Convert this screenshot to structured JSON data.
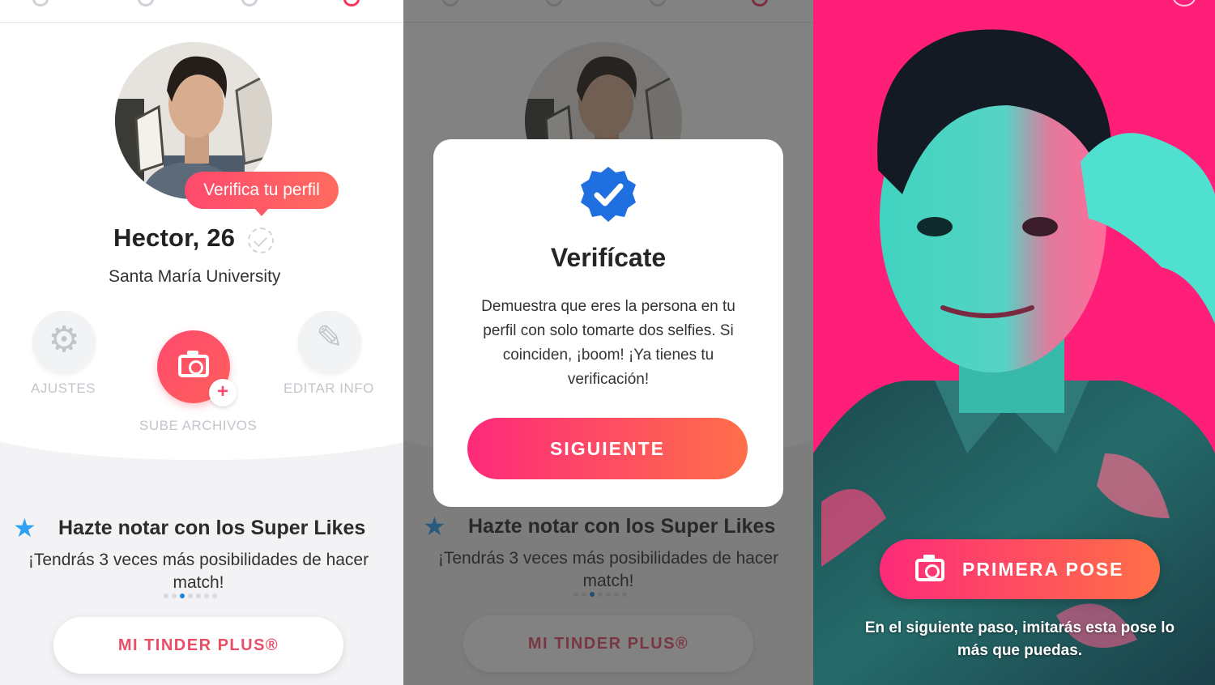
{
  "profile": {
    "verify_pill": "Verifica tu perfil",
    "name": "Hector, 26",
    "school": "Santa María University",
    "settings_label": "AJUSTES",
    "upload_label": "SUBE ARCHIVOS",
    "edit_label": "EDITAR INFO",
    "upload_plus": "+"
  },
  "promo": {
    "title": "Hazte notar con los Super Likes",
    "subtitle": "¡Tendrás 3 veces más posibilidades de hacer match!",
    "plus_button": "MI TINDER PLUS®",
    "active_dot": 2,
    "dot_count": 7
  },
  "modal": {
    "title": "Verifícate",
    "body": "Demuestra que eres la persona en tu perfil con solo tomarte dos selfies. Si coinciden, ¡boom! ¡Ya tienes tu verificación!",
    "button": "SIGUIENTE"
  },
  "pose": {
    "button": "PRIMERA POSE",
    "hint": "En el siguiente paso, imitarás esta pose lo más que puedas."
  },
  "colors": {
    "accent": "#ff4a6e",
    "pose_bg": "#ff1f79",
    "star": "#2ea1f2",
    "verified": "#1f6fe0"
  },
  "icons": [
    "settings-gear-icon",
    "camera-icon",
    "edit-pencil-icon",
    "star-icon",
    "verified-badge-icon",
    "check-icon"
  ]
}
